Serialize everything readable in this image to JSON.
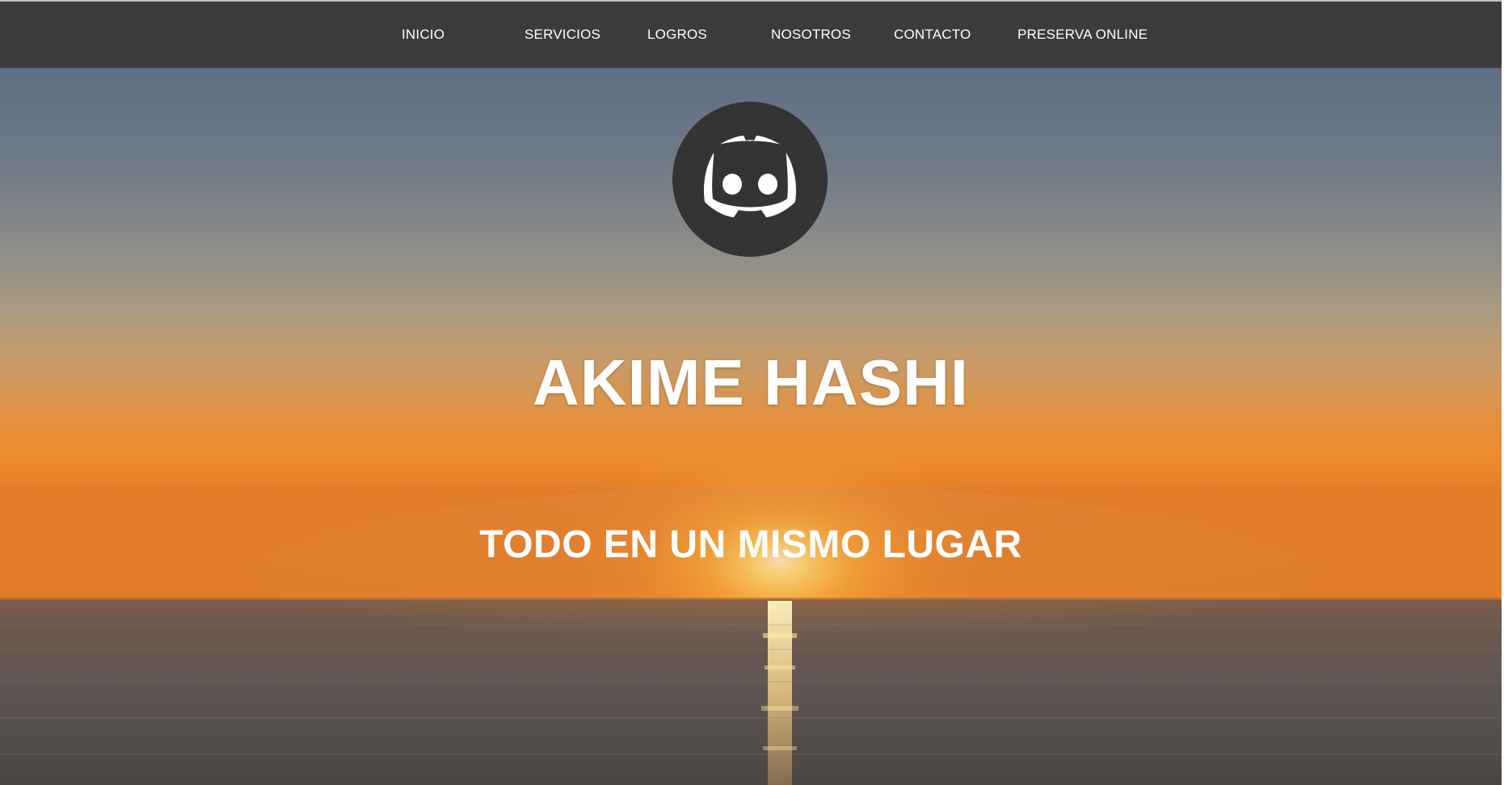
{
  "nav": {
    "items": [
      {
        "label": "INICIO"
      },
      {
        "label": "SERVICIOS"
      },
      {
        "label": "LOGROS"
      },
      {
        "label": "NOSOTROS"
      },
      {
        "label": "CONTACTO"
      },
      {
        "label": "PRESERVA ONLINE"
      }
    ]
  },
  "hero": {
    "logo_icon": "discord-logo-icon",
    "title": "AKIME HASHI",
    "subtitle": "TODO EN UN MISMO LUGAR",
    "background": "sunset-over-sea-photo"
  },
  "colors": {
    "nav_background": "#3b3b3b",
    "nav_text": "#ffffff",
    "logo_circle": "#343434",
    "hero_text": "#ffffff"
  }
}
